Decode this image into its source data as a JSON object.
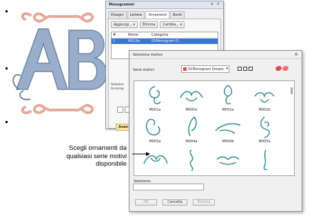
{
  "monogram_panel": {
    "title": "Monogrammi",
    "controls": "ᵾ ×",
    "tabs": [
      "Disegni",
      "Lettere",
      "Ornamenti",
      "Bordi"
    ],
    "active_tab": "Ornamenti",
    "buttons": {
      "add": "Aggiungi... ▾",
      "delete": "Elimina",
      "change": "Cambia... ▾"
    },
    "list_headers": [
      "#",
      "Nome",
      "Categoria"
    ],
    "list_row": {
      "num": "1",
      "name": "M013a",
      "category": "01Monogram O..."
    },
    "note_line1": "Selezion",
    "note_line2": "Ancorag",
    "advanced_label": "Avan"
  },
  "select_dialog": {
    "title": "Seleziona motivo",
    "close_glyph": "×",
    "series_label": "Serie motivi:",
    "series_value": "01Monogram Ornam",
    "motifs": [
      "M001a",
      "M001b",
      "M002a",
      "M002b",
      "M003a",
      "M004a",
      "M004b",
      "M005a",
      "",
      "",
      "",
      ""
    ],
    "selection_label": "Selezione:",
    "selection_value": "",
    "buttons": {
      "ok": "OK",
      "cancel": "Cancella",
      "delete": "Elimina"
    }
  },
  "callout": {
    "line1": "Scegli ornamenti da",
    "line2": "qualsiasi serie motivi",
    "line3": "disponibile"
  },
  "colors": {
    "monogram_blue": "#8fa4c4",
    "ornament_pink": "#e6a898",
    "motif_teal": "#2e8a92",
    "accent_red": "#e04848"
  }
}
